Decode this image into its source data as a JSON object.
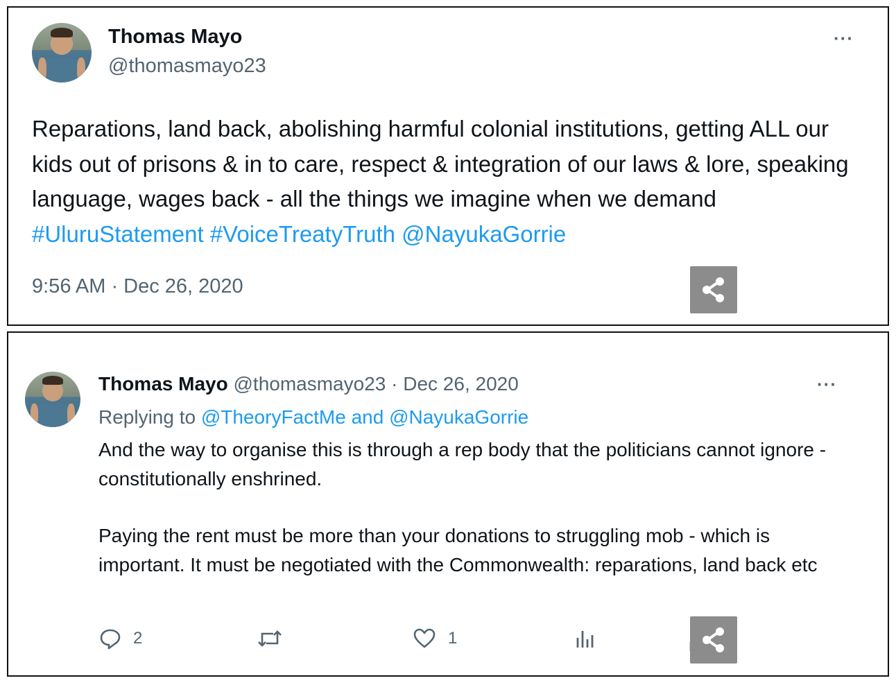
{
  "tweet": {
    "author_name": "Thomas Mayo",
    "author_handle": "@thomasmayo23",
    "more_label": "···",
    "body_text": "Reparations, land back, abolishing harmful colonial institutions, getting ALL our kids out of prisons & in to care, respect & integration of our laws & lore, speaking language, wages back - all the things we imagine when we demand",
    "links": [
      "#UluruStatement",
      "#VoiceTreatyTruth",
      "@NayukaGorrie"
    ],
    "timestamp": "9:56 AM · Dec 26, 2020"
  },
  "reply": {
    "author_name": "Thomas Mayo",
    "author_handle": "@thomasmayo23",
    "separator": " · ",
    "date": "Dec 26, 2020",
    "more_label": "···",
    "replying_prefix": "Replying to ",
    "replying_to": "@TheoryFactMe and @NayukaGorrie",
    "paragraphs": [
      "And the way to organise this is through a rep body that the politicians cannot ignore - constitutionally enshrined.",
      "Paying the rent must be more than your donations to struggling mob - which is important. It must be negotiated with the Commonwealth: reparations, land back etc"
    ],
    "actions": {
      "reply_count": "2",
      "like_count": "1"
    }
  },
  "icons": [
    "avatar",
    "more-icon",
    "share-icon",
    "reply-icon",
    "retweet-icon",
    "like-icon",
    "analytics-icon",
    "upload-icon"
  ],
  "colors": {
    "link": "#1d9bf0",
    "secondary_text": "#536471",
    "primary_text": "#0f1419",
    "share_overlay": "#8c8c8c"
  }
}
